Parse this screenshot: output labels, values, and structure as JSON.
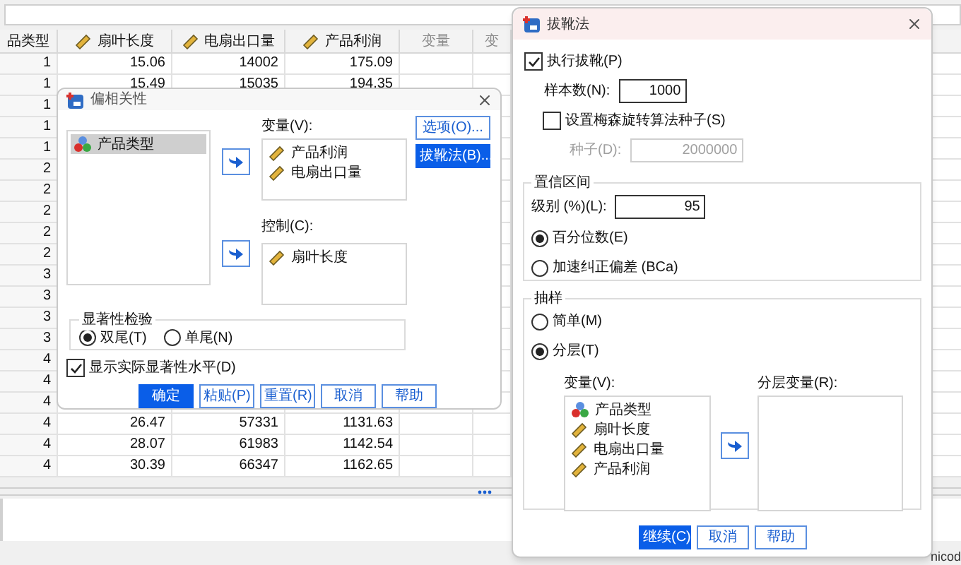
{
  "data_view": {
    "columns": [
      {
        "label": "品类型",
        "kind": "text"
      },
      {
        "label": "扇叶长度",
        "kind": "scale"
      },
      {
        "label": "电扇出口量",
        "kind": "scale"
      },
      {
        "label": "产品利润",
        "kind": "scale"
      },
      {
        "label": "变量",
        "kind": "empty"
      },
      {
        "label": "变",
        "kind": "empty"
      }
    ],
    "rows": [
      [
        "1",
        "15.06",
        "14002",
        "175.09"
      ],
      [
        "1",
        "15.49",
        "15035",
        "194.35"
      ],
      [
        "1"
      ],
      [
        "1"
      ],
      [
        "1"
      ],
      [
        "2"
      ],
      [
        "2"
      ],
      [
        "2"
      ],
      [
        "2"
      ],
      [
        "2"
      ],
      [
        "3"
      ],
      [
        "3"
      ],
      [
        "3"
      ],
      [
        "3"
      ],
      [
        "4"
      ],
      [
        "4"
      ],
      [
        "4"
      ],
      [
        "4",
        "26.47",
        "57331",
        "1131.63"
      ],
      [
        "4",
        "28.07",
        "61983",
        "1142.54"
      ],
      [
        "4",
        "30.39",
        "66347",
        "1162.65"
      ]
    ]
  },
  "partial_corr_dialog": {
    "title": "偏相关性",
    "source_list": [
      {
        "label": "产品类型",
        "kind": "nominal",
        "selected": true
      }
    ],
    "variables_label": "变量(V):",
    "variables": [
      {
        "label": "产品利润",
        "kind": "scale",
        "selected": false
      },
      {
        "label": "电扇出口量",
        "kind": "scale",
        "selected": false
      }
    ],
    "controls_label": "控制(C):",
    "controls": [
      {
        "label": "扇叶长度",
        "kind": "scale",
        "selected": false
      }
    ],
    "side_buttons": [
      {
        "label": "选项(O)...",
        "highlighted": false
      },
      {
        "label": "拔靴法(B)...",
        "highlighted": true
      }
    ],
    "test_group": {
      "title": "显著性检验",
      "options": [
        {
          "label": "双尾(T)",
          "selected": true
        },
        {
          "label": "单尾(N)",
          "selected": false
        }
      ]
    },
    "show_significance": {
      "label": "显示实际显著性水平(D)",
      "checked": true
    },
    "buttons": [
      {
        "label": "确定",
        "highlighted": true
      },
      {
        "label": "粘贴(P)",
        "highlighted": false
      },
      {
        "label": "重置(R)",
        "highlighted": false
      },
      {
        "label": "取消",
        "highlighted": false
      },
      {
        "label": "帮助",
        "highlighted": false
      }
    ]
  },
  "bootstrap_dialog": {
    "title": "拔靴法",
    "perform": {
      "label": "执行拔靴(P)",
      "checked": true
    },
    "samples": {
      "label": "样本数(N):",
      "value": "1000",
      "disabled": false
    },
    "set_seed": {
      "label": "设置梅森旋转算法种子(S)",
      "checked": false
    },
    "seed": {
      "label": "种子(D):",
      "value": "2000000",
      "disabled": true
    },
    "confidence": {
      "title": "置信区间",
      "level": {
        "label": "级别 (%)(L):",
        "value": "95",
        "disabled": false
      },
      "options": [
        {
          "label": "百分位数(E)",
          "selected": true
        },
        {
          "label": "加速纠正偏差 (BCa)",
          "selected": false
        }
      ]
    },
    "sampling": {
      "title": "抽样",
      "options": [
        {
          "label": "简单(M)",
          "selected": false
        },
        {
          "label": "分层(T)",
          "selected": true
        }
      ],
      "variables_label": "变量(V):",
      "variables": [
        {
          "label": "产品类型",
          "kind": "nominal",
          "selected": false
        },
        {
          "label": "扇叶长度",
          "kind": "scale",
          "selected": false
        },
        {
          "label": "电扇出口量",
          "kind": "scale",
          "selected": false
        },
        {
          "label": "产品利润",
          "kind": "scale",
          "selected": false
        }
      ],
      "strata_label": "分层变量(R):"
    },
    "buttons": [
      {
        "label": "继续(C)",
        "highlighted": true
      },
      {
        "label": "取消",
        "highlighted": false
      },
      {
        "label": "帮助",
        "highlighted": false
      }
    ]
  },
  "status_text": "nicod"
}
